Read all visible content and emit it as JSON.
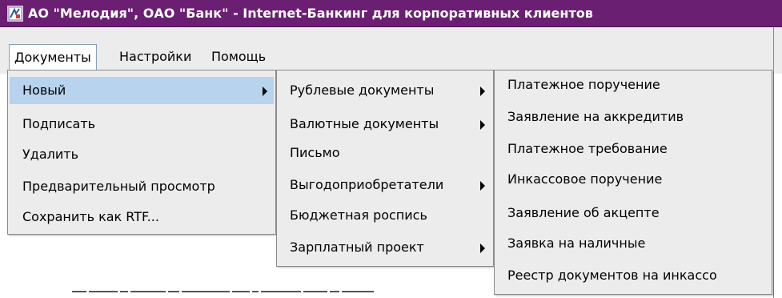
{
  "window": {
    "title": "АО \"Мелодия\", ОАО \"Банк\" - Internet-Банкинг для корпоративных клиентов"
  },
  "menubar": {
    "items": [
      {
        "label": "Документы"
      },
      {
        "label": "Настройки"
      },
      {
        "label": "Помощь"
      }
    ]
  },
  "documents_menu": {
    "items": [
      {
        "label": "Новый"
      },
      {
        "label": "Подписать"
      },
      {
        "label": "Удалить"
      },
      {
        "label": "Предварительный просмотр"
      },
      {
        "label": "Сохранить как RTF..."
      }
    ]
  },
  "new_submenu": {
    "items": [
      {
        "label": "Рублевые документы"
      },
      {
        "label": "Валютные документы"
      },
      {
        "label": "Письмо"
      },
      {
        "label": "Выгодоприобретатели"
      },
      {
        "label": "Бюджетная роспись"
      },
      {
        "label": "Зарплатный проект"
      }
    ]
  },
  "ruble_submenu": {
    "items": [
      {
        "label": "Платежное поручение"
      },
      {
        "label": "Заявление на аккредитив"
      },
      {
        "label": "Платежное требование"
      },
      {
        "label": "Инкассовое поручение"
      },
      {
        "label": "Заявление об акцепте"
      },
      {
        "label": "Заявка на наличные"
      },
      {
        "label": "Реестр документов на инкассо"
      }
    ]
  },
  "colors": {
    "titlebar": "#6b1f73",
    "menu_background": "#ececec",
    "highlight": "#b7d3ee"
  }
}
